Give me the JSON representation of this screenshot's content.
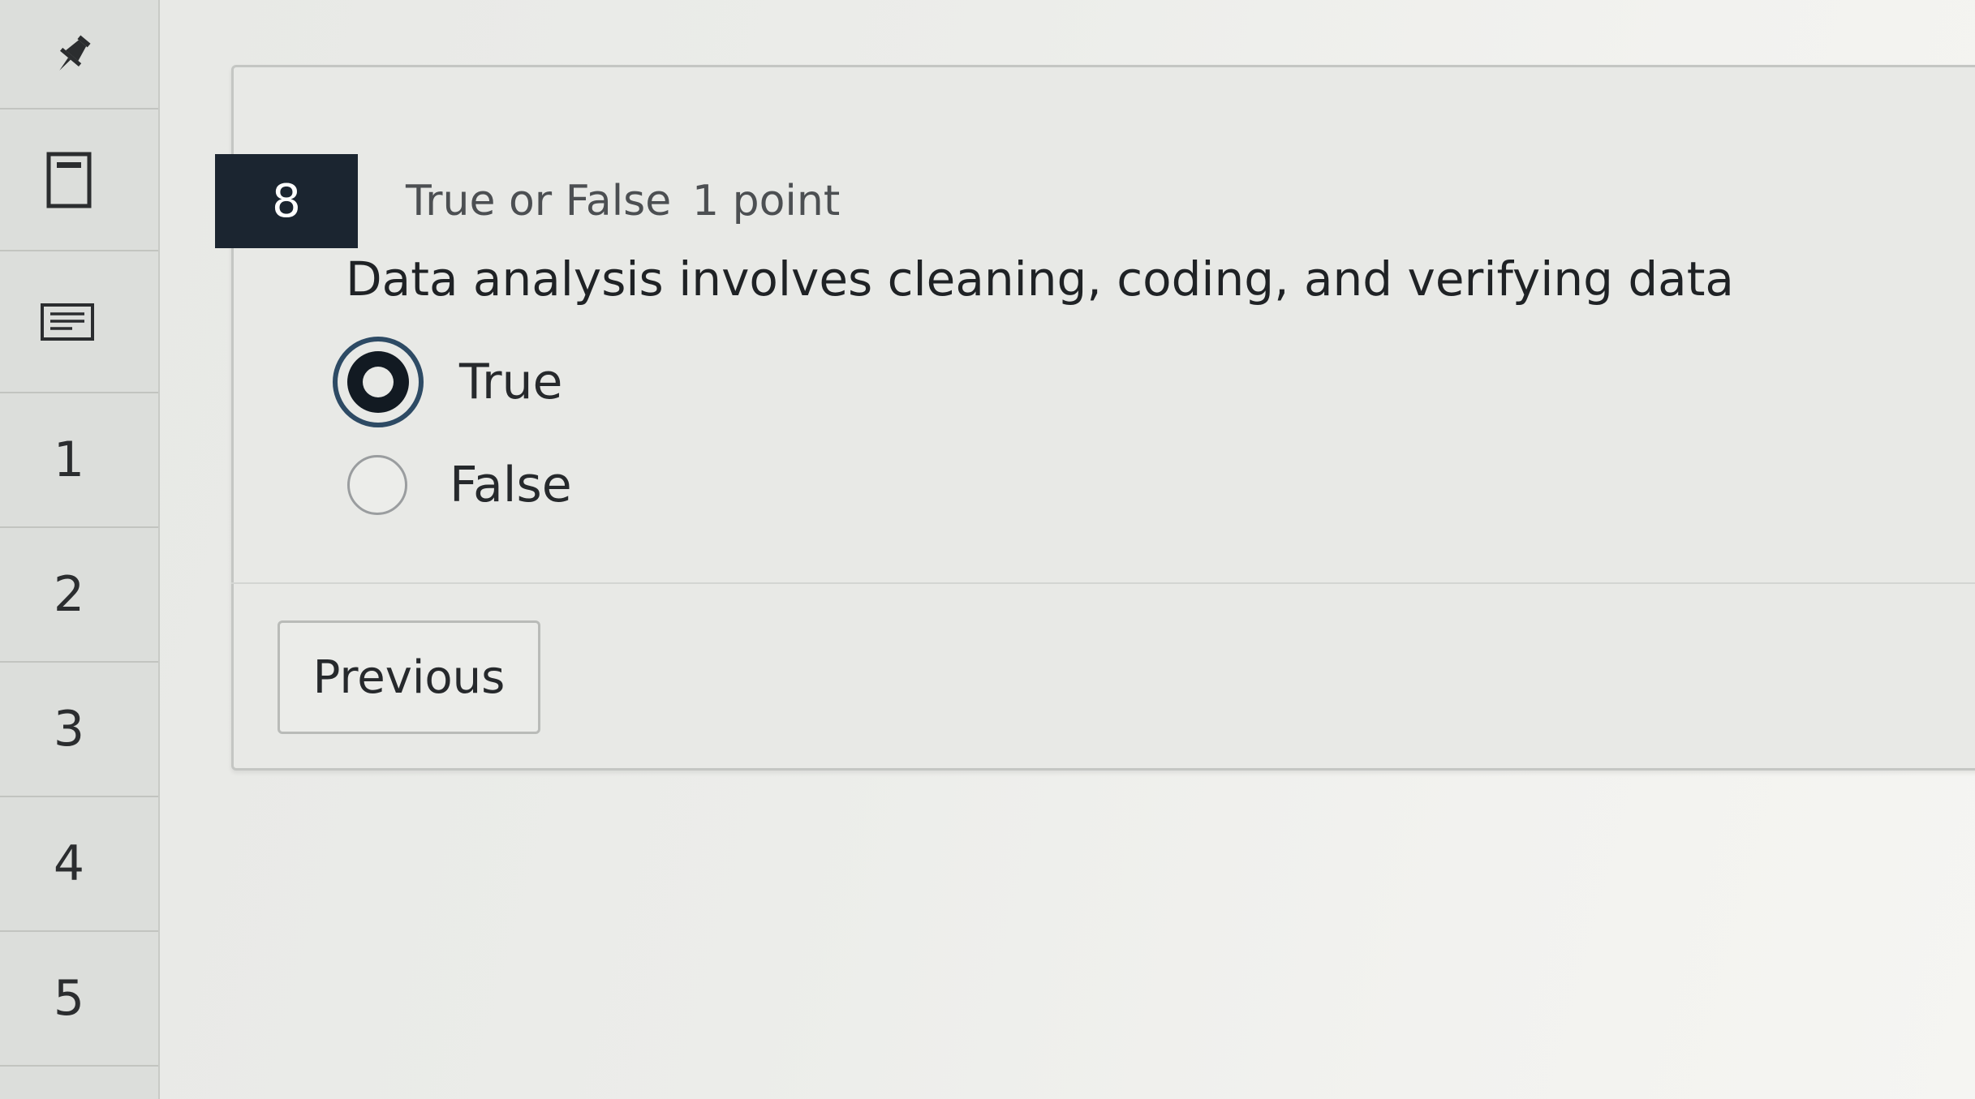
{
  "sidebar": {
    "pin_icon": "pin-icon",
    "calculator_icon": "calculator-icon",
    "notes_icon": "notes-icon",
    "question_links": [
      "1",
      "2",
      "3",
      "4",
      "5"
    ]
  },
  "question": {
    "number": "8",
    "type": "True or False",
    "points": "1 point",
    "text": "Data analysis involves cleaning, coding, and verifying data",
    "options": [
      {
        "label": "True",
        "selected": true
      },
      {
        "label": "False",
        "selected": false
      }
    ]
  },
  "navigation": {
    "previous_label": "Previous"
  },
  "colors": {
    "question_badge": "#1b2530",
    "radio_selected_ring": "#2d4a64"
  }
}
